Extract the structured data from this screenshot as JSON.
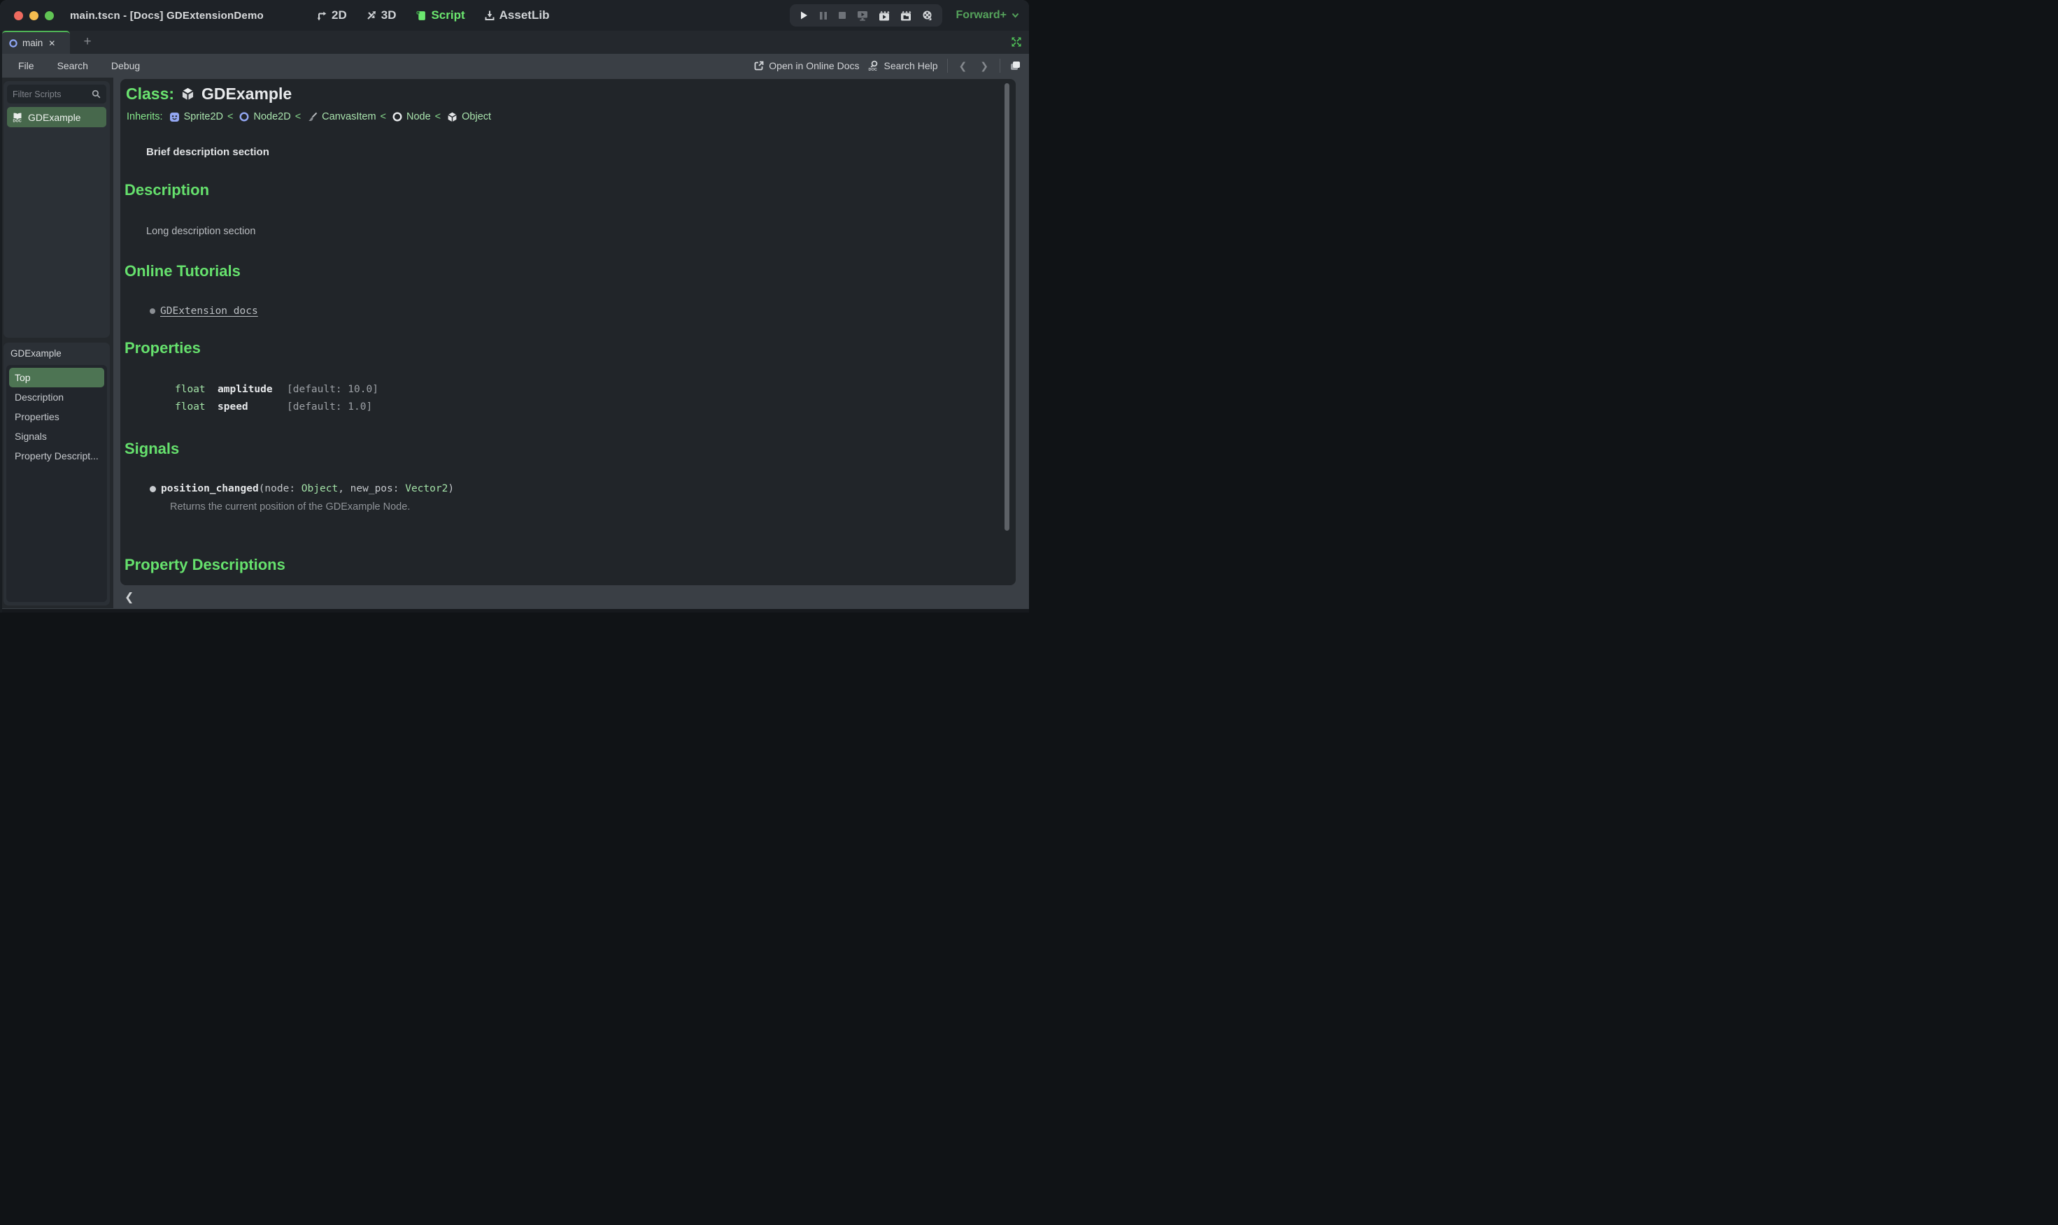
{
  "window": {
    "title": "main.tscn - [Docs] GDExtensionDemo"
  },
  "main_toolbar": {
    "modes": [
      {
        "label": "2D",
        "active": false
      },
      {
        "label": "3D",
        "active": false
      },
      {
        "label": "Script",
        "active": true
      },
      {
        "label": "AssetLib",
        "active": false
      }
    ],
    "playback_buttons": [
      "play",
      "pause",
      "stop",
      "play-scene",
      "play-current-scene",
      "play-custom-scene",
      "movie-maker-mode"
    ],
    "renderer": {
      "label": "Forward+",
      "chevron": "▾"
    }
  },
  "tab_bar": {
    "tabs": [
      {
        "label": "main",
        "active": true
      }
    ],
    "close_glyph": "✕",
    "add_glyph": "+"
  },
  "menu_bar": {
    "menus": [
      {
        "label": "File"
      },
      {
        "label": "Search"
      },
      {
        "label": "Debug"
      }
    ],
    "open_online_docs_label": "Open in Online Docs",
    "search_help_label": "Search Help",
    "back_glyph": "❮",
    "forward_glyph": "❯"
  },
  "script_dock": {
    "filter_placeholder": "Filter Scripts",
    "scripts": [
      {
        "name": "GDExample",
        "selected": true
      }
    ],
    "outline_header": "GDExample",
    "outline": [
      {
        "label": "Top",
        "selected": true
      },
      {
        "label": "Description",
        "selected": false
      },
      {
        "label": "Properties",
        "selected": false
      },
      {
        "label": "Signals",
        "selected": false
      },
      {
        "label": "Property Descript...",
        "selected": false
      }
    ]
  },
  "doc": {
    "class_label": "Class:",
    "class_name": "GDExample",
    "inherits_label": "Inherits:",
    "separator": "<",
    "inherits_chain": [
      {
        "name": "Sprite2D"
      },
      {
        "name": "Node2D"
      },
      {
        "name": "CanvasItem"
      },
      {
        "name": "Node"
      },
      {
        "name": "Object"
      }
    ],
    "brief": "Brief description section",
    "description": {
      "heading": "Description",
      "body": "Long description section"
    },
    "tutorials": {
      "heading": "Online Tutorials",
      "links": [
        {
          "label": "GDExtension docs"
        }
      ]
    },
    "properties": {
      "heading": "Properties",
      "rows": [
        {
          "type": "float",
          "name": "amplitude",
          "default": "[default: 10.0]"
        },
        {
          "type": "float",
          "name": "speed",
          "default": "[default: 1.0]"
        }
      ]
    },
    "signals": {
      "heading": "Signals",
      "items": [
        {
          "name": "position_changed",
          "args_prefix": "(node: ",
          "arg1_type": "Object",
          "args_mid": ", new_pos: ",
          "arg2_type": "Vector2",
          "args_suffix": ")",
          "description": "Returns the current position of the GDExample Node."
        }
      ]
    },
    "property_descriptions": {
      "heading": "Property Descriptions"
    }
  },
  "bottom_bar": {
    "collapse_glyph": "❮"
  },
  "colors": {
    "accent_green": "#66e16d",
    "link_green": "#a3e2a7",
    "selection_green": "#4a7051",
    "tab_accent_green": "#4fb456",
    "renderer_green": "#55a25b",
    "content_bg": "#212529",
    "panel_bg": "#2b3036",
    "base_bg": "#3a3f45"
  }
}
